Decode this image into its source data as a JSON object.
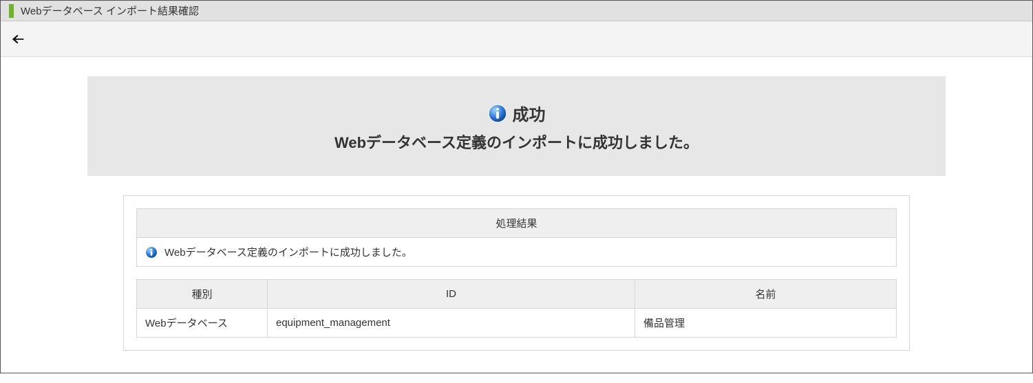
{
  "titlebar": {
    "title": "Webデータベース インポート結果確認"
  },
  "banner": {
    "status": "成功",
    "message": "Webデータベース定義のインポートに成功しました。"
  },
  "result": {
    "header": "処理結果",
    "message": "Webデータベース定義のインポートに成功しました。"
  },
  "details": {
    "headers": {
      "type": "種別",
      "id": "ID",
      "name": "名前"
    },
    "rows": [
      {
        "type": "Webデータベース",
        "id": "equipment_management",
        "name": "備品管理"
      }
    ]
  }
}
